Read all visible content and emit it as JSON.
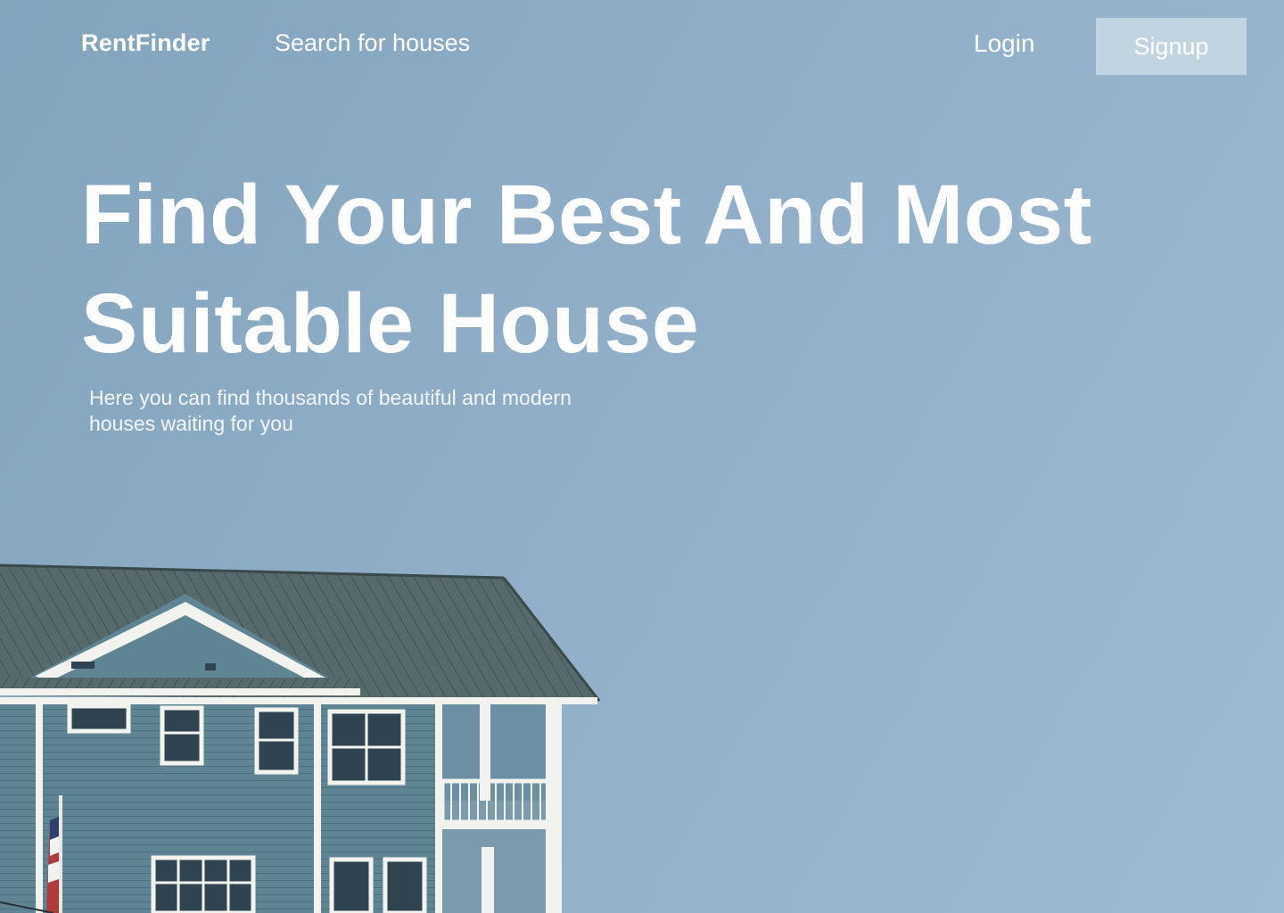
{
  "nav": {
    "logo": "RentFinder",
    "search_link": "Search for houses",
    "login": "Login",
    "signup": "Signup"
  },
  "hero": {
    "title": "Find Your Best And Most Suitable House",
    "subtitle": "Here you can find thousands of beautiful and modern houses waiting for you"
  },
  "colors": {
    "background": "#8fadc6",
    "signup_button": "#c1d4e2",
    "house_siding": "#5f8595",
    "roof": "#4a5c5e",
    "trim": "#f2f2ee"
  },
  "image": {
    "house_icon": "house-photo"
  }
}
